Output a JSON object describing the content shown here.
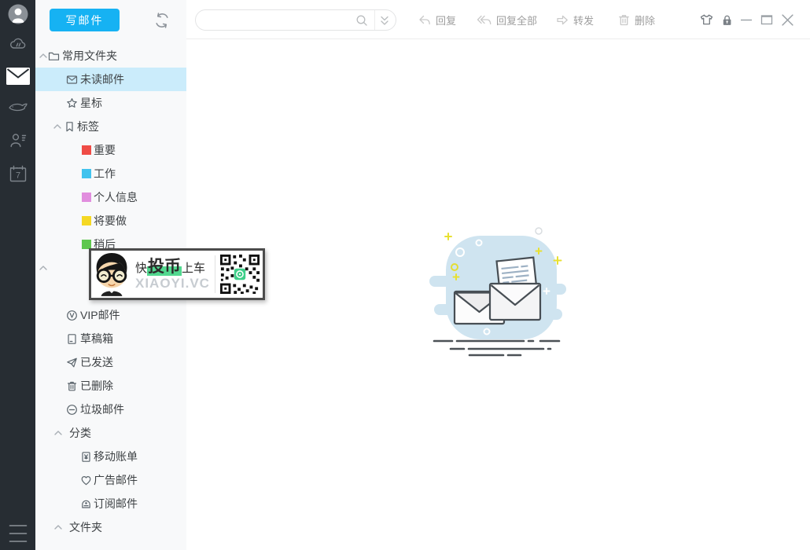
{
  "colors": {
    "accent": "#16b2f3",
    "selected_bg": "#cbecfb",
    "rail_bg": "#272d33",
    "label_red": "#ef4c46",
    "label_blue": "#41c3ee",
    "label_pink": "#e18ede",
    "label_yellow": "#f5d823",
    "label_green": "#5ec74e",
    "watermark_highlight": "#52d88f"
  },
  "rail": {
    "items": [
      "avatar",
      "cloud-sync-icon",
      "mail-icon",
      "fish-icon",
      "contacts-icon",
      "calendar-icon",
      "menu-icon"
    ],
    "active_item": "mail-icon",
    "calendar_day": "7"
  },
  "sidebar": {
    "compose_label": "写邮件",
    "tree": [
      {
        "name": "common-folders",
        "label": "常用文件夹",
        "type": "g1",
        "icon": "folder",
        "arrow": true
      },
      {
        "name": "unread-mail",
        "label": "未读邮件",
        "type": "item",
        "icon": "mail",
        "selected": true
      },
      {
        "name": "starred",
        "label": "星标",
        "type": "item",
        "icon": "star"
      },
      {
        "name": "tags",
        "label": "标签",
        "type": "g2",
        "icon": "tag",
        "arrow": true
      },
      {
        "name": "label-important",
        "label": "重要",
        "type": "label",
        "color": "#ef4c46"
      },
      {
        "name": "label-work",
        "label": "工作",
        "type": "label",
        "color": "#41c3ee"
      },
      {
        "name": "label-personal",
        "label": "个人信息",
        "type": "label",
        "color": "#e18ede"
      },
      {
        "name": "label-todo",
        "label": "将要做",
        "type": "label",
        "color": "#f5d823"
      },
      {
        "name": "label-later",
        "label": "稍后",
        "type": "label",
        "color": "#5ec74e"
      },
      {
        "name": "hidden-account",
        "label": "",
        "type": "stub",
        "arrow": true
      },
      {
        "name": "hidden-row",
        "label": "",
        "type": "spacer"
      },
      {
        "name": "vip-mail",
        "label": "VIP邮件",
        "type": "item",
        "icon": "vip"
      },
      {
        "name": "drafts",
        "label": "草稿箱",
        "type": "item",
        "icon": "draft"
      },
      {
        "name": "sent",
        "label": "已发送",
        "type": "item",
        "icon": "send"
      },
      {
        "name": "deleted",
        "label": "已删除",
        "type": "item",
        "icon": "trash"
      },
      {
        "name": "junk-mail",
        "label": "垃圾邮件",
        "type": "item",
        "icon": "block"
      },
      {
        "name": "categories",
        "label": "分类",
        "type": "g3",
        "arrow": true
      },
      {
        "name": "mobile-bills",
        "label": "移动账单",
        "type": "item3",
        "icon": "bill"
      },
      {
        "name": "ad-mail",
        "label": "广告邮件",
        "type": "item3",
        "icon": "ad"
      },
      {
        "name": "subscription-mail",
        "label": "订阅邮件",
        "type": "item3",
        "icon": "subscribe"
      },
      {
        "name": "folders",
        "label": "文件夹",
        "type": "g3",
        "arrow": true
      }
    ]
  },
  "toolbar": {
    "search_value": "",
    "search_placeholder": "",
    "buttons": [
      {
        "name": "reply",
        "label": "回复"
      },
      {
        "name": "reply-all",
        "label": "回复全部"
      },
      {
        "name": "forward",
        "label": "转发"
      },
      {
        "name": "delete",
        "label": "删除"
      }
    ],
    "window_controls": [
      "skin",
      "lock",
      "minimize",
      "maximize",
      "close"
    ]
  },
  "watermark": {
    "line1_prefix": "快",
    "line1_highlight": "投币",
    "line1_suffix": "上车",
    "line2": "XIAOYI.VC"
  }
}
